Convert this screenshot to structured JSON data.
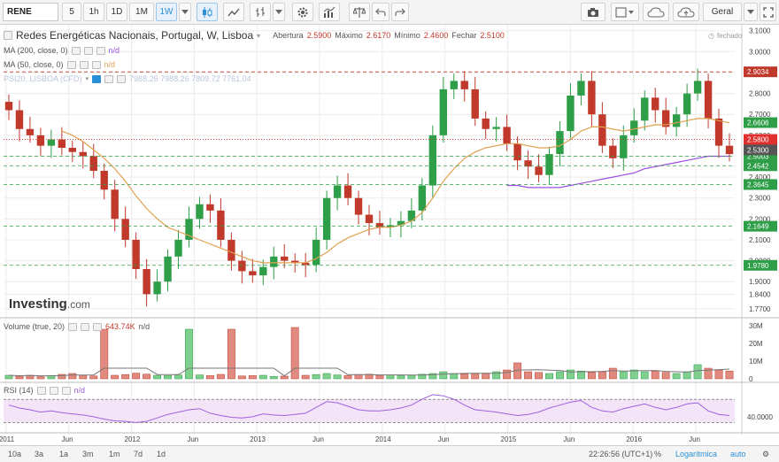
{
  "toolbar": {
    "symbol": "RENE",
    "intervals": [
      "5",
      "1h",
      "1D",
      "1M",
      "1W"
    ],
    "active_interval": "1W",
    "layout_label": "Geral"
  },
  "header": {
    "title": "Redes Energéticas Nacionais, Portugal, W, Lisboa",
    "open_label": "Abertura",
    "open_value": "2.5900",
    "high_label": "Máximo",
    "high_value": "2.6170",
    "low_label": "Mínimo",
    "low_value": "2.4600",
    "close_label": "Fechar",
    "close_value": "2.5100",
    "status": "fechado"
  },
  "indicators": {
    "ma200_label": "MA (200, close, 0)",
    "ma200_value": "n/d",
    "ma50_label": "MA (50, close, 0)",
    "ma50_value": "n/d",
    "psi20_label": "PSI20, LISBOA (CFD)",
    "psi20_values": "7988.26  7988.26  7809.72  7761.04",
    "volume_label": "Volume (true, 20)",
    "volume_value": "643.74K",
    "volume_na": "n/d",
    "rsi_label": "RSI (14)",
    "rsi_value": "n/d"
  },
  "brand": {
    "logo_main": "Investing",
    "logo_suffix": ".com"
  },
  "colors": {
    "up": "#2e9e48",
    "down": "#c0392b",
    "ma50": "#e0a050",
    "ma200": "#9b4fe0",
    "rsi": "#a060e0",
    "rsi_band": "#f3e4f7",
    "grid": "#ececec"
  },
  "price_axis": {
    "ticks": [
      "3.1000",
      "3.0000",
      "2.9000",
      "2.8000",
      "2.7000",
      "2.6000",
      "2.5000",
      "2.4000",
      "2.3000",
      "2.2000",
      "2.1000",
      "2.0000",
      "1.9000",
      "1.8400",
      "1.7700"
    ],
    "markers": [
      {
        "label": "2.9034",
        "value": 2.9034,
        "color": "#c0392b",
        "line": "dashed"
      },
      {
        "label": "2.5800",
        "value": 2.58,
        "color": "#e03030",
        "line": "dotted"
      },
      {
        "label": "2.5003",
        "value": 2.5003,
        "color": "#2e9e48",
        "line": "dashed"
      },
      {
        "label": "2.4542",
        "value": 2.4542,
        "color": "#2e9e48",
        "line": "dashed"
      },
      {
        "label": "2.3645",
        "value": 2.3645,
        "color": "#2e9e48",
        "line": "dashed"
      },
      {
        "label": "2.6606",
        "value": 2.6606,
        "color": "#2e9e48",
        "line": "none"
      },
      {
        "label": "2.1649",
        "value": 2.1649,
        "color": "#2e9e48",
        "line": "dashed"
      },
      {
        "label": "2.5300",
        "value": 2.53,
        "color": "#555555",
        "line": "none"
      },
      {
        "label": "1.9780",
        "value": 1.978,
        "color": "#2e9e48",
        "line": "dashed"
      }
    ]
  },
  "volume_axis": {
    "ticks": [
      "30M",
      "20M",
      "10M",
      "0"
    ]
  },
  "rsi_axis": {
    "ticks": [
      "40.0000"
    ]
  },
  "time_axis": {
    "labels": [
      "2011",
      "Jun",
      "2012",
      "Jun",
      "2013",
      "Jun",
      "2014",
      "Jun",
      "2015",
      "Jun",
      "2016",
      "Jun"
    ],
    "positions": [
      0,
      0.5,
      1,
      1.5,
      2,
      2.5,
      3,
      3.5,
      4,
      4.5,
      5,
      5.5
    ]
  },
  "bottom_bar": {
    "ranges": [
      "10a",
      "3a",
      "1a",
      "3m",
      "1m",
      "7d",
      "1d"
    ],
    "time": "22:26:56 (UTC+1)",
    "percent": "%",
    "log": "Logarítmica",
    "auto": "auto"
  },
  "chart_data": {
    "type": "candlestick",
    "interval": "weekly",
    "x_start": "2010-10-01",
    "x_end": "2016-08-01",
    "ylim": [
      1.74,
      3.12
    ],
    "series": [
      {
        "name": "Price (close)",
        "values": [
          2.72,
          2.63,
          2.6,
          2.55,
          2.58,
          2.54,
          2.52,
          2.5,
          2.43,
          2.34,
          2.2,
          2.1,
          1.96,
          1.84,
          1.9,
          2.02,
          2.1,
          2.2,
          2.27,
          2.24,
          2.1,
          2.0,
          1.95,
          1.93,
          1.97,
          2.02,
          2.0,
          1.99,
          1.98,
          2.1,
          2.3,
          2.36,
          2.3,
          2.22,
          2.18,
          2.16,
          2.17,
          2.19,
          2.24,
          2.36,
          2.6,
          2.82,
          2.86,
          2.82,
          2.68,
          2.63,
          2.64,
          2.56,
          2.48,
          2.45,
          2.41,
          2.51,
          2.62,
          2.79,
          2.86,
          2.7,
          2.55,
          2.49,
          2.6,
          2.67,
          2.78,
          2.72,
          2.64,
          2.7,
          2.8,
          2.86,
          2.68,
          2.55,
          2.51
        ]
      },
      {
        "name": "MA (50, close, 0)",
        "values": [
          null,
          null,
          null,
          null,
          null,
          2.62,
          2.6,
          2.57,
          2.53,
          2.49,
          2.44,
          2.38,
          2.31,
          2.25,
          2.2,
          2.16,
          2.14,
          2.12,
          2.1,
          2.08,
          2.06,
          2.04,
          2.02,
          2.0,
          1.99,
          1.99,
          1.99,
          1.99,
          1.99,
          2.01,
          2.04,
          2.08,
          2.11,
          2.13,
          2.15,
          2.16,
          2.16,
          2.17,
          2.19,
          2.23,
          2.3,
          2.38,
          2.44,
          2.49,
          2.52,
          2.54,
          2.55,
          2.56,
          2.56,
          2.55,
          2.54,
          2.54,
          2.55,
          2.58,
          2.62,
          2.64,
          2.64,
          2.63,
          2.62,
          2.63,
          2.64,
          2.65,
          2.65,
          2.66,
          2.67,
          2.68,
          2.68,
          2.67,
          2.66
        ]
      },
      {
        "name": "MA (200, close, 0)",
        "values": [
          null,
          null,
          null,
          null,
          null,
          null,
          null,
          null,
          null,
          null,
          null,
          null,
          null,
          null,
          null,
          null,
          null,
          null,
          null,
          null,
          null,
          null,
          null,
          null,
          null,
          null,
          null,
          null,
          null,
          null,
          null,
          null,
          null,
          null,
          null,
          null,
          null,
          null,
          null,
          null,
          null,
          null,
          null,
          null,
          null,
          null,
          null,
          2.36,
          2.36,
          2.35,
          2.35,
          2.35,
          2.35,
          2.36,
          2.37,
          2.38,
          2.39,
          2.4,
          2.41,
          2.42,
          2.44,
          2.45,
          2.46,
          2.47,
          2.48,
          2.49,
          2.5,
          2.5,
          2.5
        ]
      }
    ],
    "volume_values_M": [
      2,
      1.5,
      2,
      1.2,
      1.8,
      2.5,
      3,
      2,
      1.6,
      28,
      2,
      2.4,
      3.2,
      2.6,
      2,
      1.8,
      2.2,
      28,
      2.2,
      1.8,
      2.5,
      28,
      1.6,
      1.8,
      2,
      1.4,
      1.5,
      29,
      2,
      2.4,
      3,
      2.2,
      1.8,
      2.4,
      2.6,
      2,
      2.2,
      1.8,
      2,
      2.6,
      3,
      4,
      3,
      2.6,
      3,
      3.2,
      4,
      5,
      9,
      4,
      3.6,
      3,
      4,
      5,
      4.4,
      3.6,
      4,
      6,
      4,
      5,
      4,
      4.4,
      3.6,
      3,
      4,
      8,
      6,
      5,
      4.4
    ],
    "rsi_values": [
      60,
      55,
      52,
      48,
      50,
      47,
      45,
      43,
      40,
      36,
      33,
      32,
      30,
      32,
      38,
      44,
      48,
      52,
      54,
      46,
      42,
      39,
      38,
      40,
      45,
      43,
      42,
      44,
      46,
      56,
      66,
      64,
      58,
      52,
      50,
      50,
      52,
      55,
      60,
      70,
      78,
      76,
      70,
      60,
      52,
      50,
      48,
      45,
      42,
      44,
      48,
      55,
      60,
      65,
      68,
      56,
      50,
      48,
      54,
      58,
      62,
      56,
      52,
      56,
      62,
      64,
      50,
      44,
      42
    ]
  }
}
